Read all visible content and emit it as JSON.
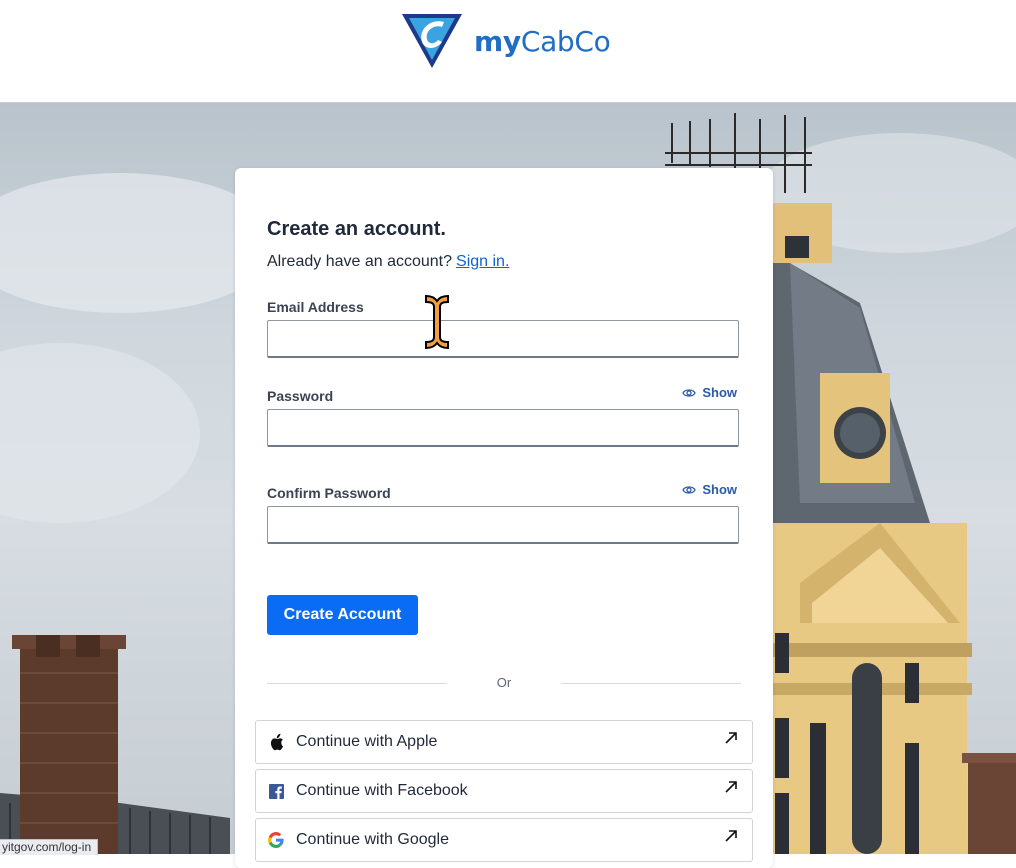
{
  "brand": {
    "name_bold": "my",
    "name_regular": "CabCo",
    "color": "#1f6dc7"
  },
  "form": {
    "title": "Create an account.",
    "signin_prompt": "Already have an account?",
    "signin_link": "Sign in.",
    "email_label": "Email Address",
    "email_value": "",
    "password_label": "Password",
    "password_value": "",
    "password_show": "Show",
    "confirm_label": "Confirm Password",
    "confirm_value": "",
    "confirm_show": "Show",
    "submit_label": "Create Account",
    "divider_text": "Or"
  },
  "social": [
    {
      "label": "Continue with Apple",
      "icon": "apple-icon"
    },
    {
      "label": "Continue with Facebook",
      "icon": "facebook-icon"
    },
    {
      "label": "Continue with Google",
      "icon": "google-icon"
    }
  ],
  "status_bar": {
    "url": "yitgov.com/log-in"
  },
  "colors": {
    "primary": "#0a6cf5",
    "link": "#0b63d6"
  }
}
